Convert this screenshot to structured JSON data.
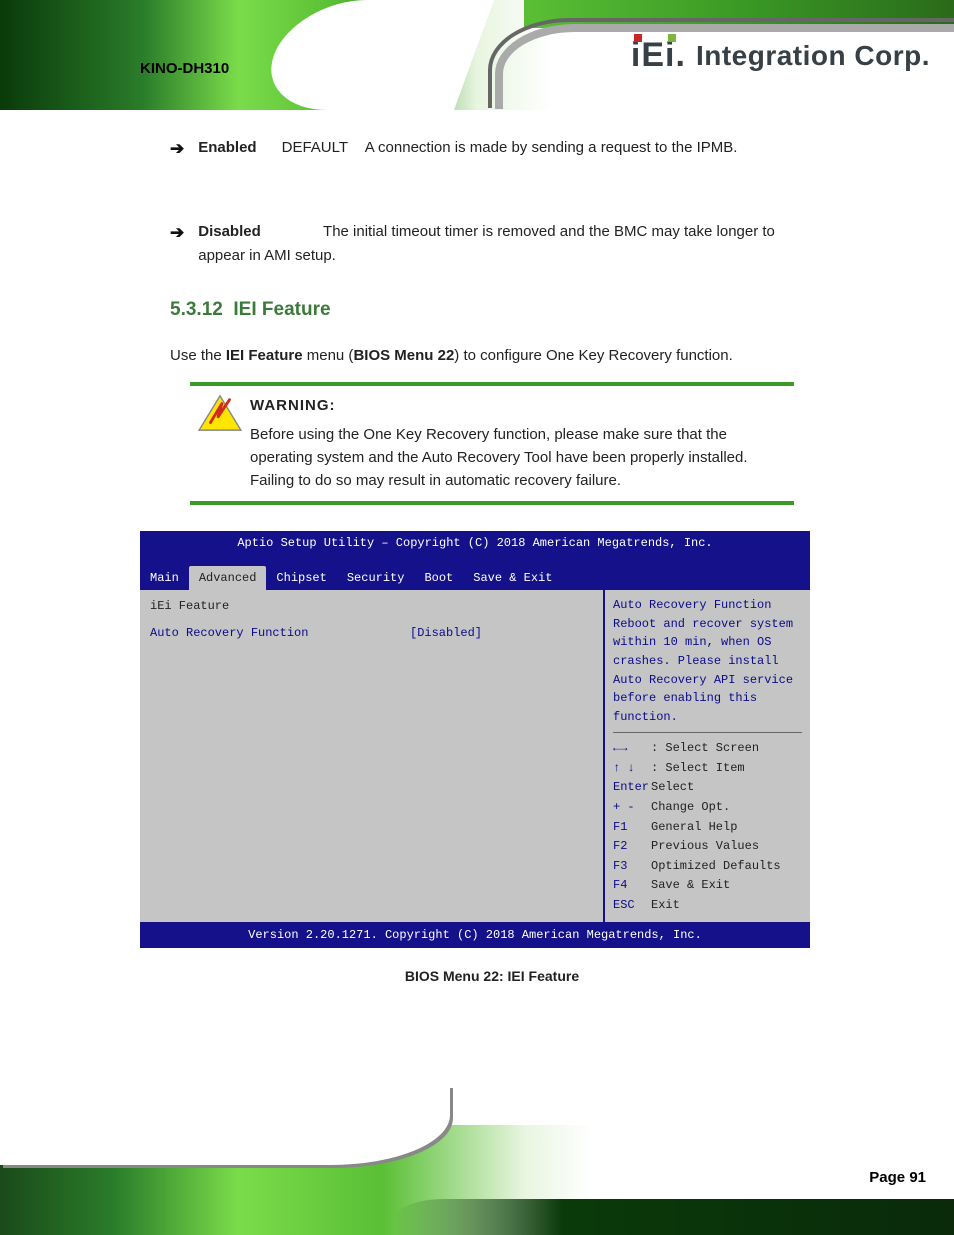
{
  "header": {
    "logo_i": "i",
    "logo_E": "E",
    "logo_i2": "i",
    "logo_dot": ".",
    "logo_text": "Integration Corp.",
    "model": "KINO-DH310"
  },
  "bullets": {
    "b1": {
      "label": "Enabled",
      "default": "DEFAULT",
      "desc": "A connection is made by sending a request to the IPMB."
    },
    "b2": {
      "label": "Disabled",
      "desc": "The initial timeout timer is removed and the BMC may take longer to appear in AMI setup."
    }
  },
  "section": {
    "number": "5.3.12",
    "title": "IEI Feature"
  },
  "intro": "Use the IEI Feature menu (BIOS Menu 22) to configure One Key Recovery function.",
  "warning": {
    "title": "WARNING:",
    "text": "Before using the One Key Recovery function, please make sure that the operating system and the Auto Recovery Tool have been properly installed. Failing to do so may result in automatic recovery failure."
  },
  "bios": {
    "setup_title": "Aptio Setup Utility – Copyright (C) 2018 American Megatrends, Inc.",
    "tabs": {
      "main": "Main",
      "advanced": "Advanced",
      "chipset": "Chipset",
      "security": "Security",
      "boot": "Boot",
      "saveexit": "Save & Exit"
    },
    "row1": {
      "label": "iEi Feature"
    },
    "row2": {
      "label": "Auto Recovery Function",
      "value": "[Disabled]"
    },
    "help": "Auto Recovery Function Reboot and recover system within 10 min, when OS crashes. Please install Auto Recovery API service before enabling this function.",
    "keys": {
      "lr": {
        "k": "←→",
        "t": ": Select Screen"
      },
      "ud": {
        "k": "↑ ↓",
        "t": ": Select Item"
      },
      "enter": {
        "k": "Enter",
        "t": "Select"
      },
      "pm": {
        "k": "+ -",
        "t": "Change Opt."
      },
      "f1": {
        "k": "F1",
        "t": "General Help"
      },
      "f2": {
        "k": "F2",
        "t": "Previous Values"
      },
      "f3": {
        "k": "F3",
        "t": "Optimized Defaults"
      },
      "f4": {
        "k": "F4",
        "t": "Save & Exit"
      },
      "esc": {
        "k": "ESC",
        "t": "Exit"
      }
    },
    "footer": "Version 2.20.1271. Copyright (C) 2018 American Megatrends, Inc."
  },
  "caption": "BIOS Menu 22: IEI Feature",
  "pager": {
    "label": "Page",
    "num": "91"
  }
}
